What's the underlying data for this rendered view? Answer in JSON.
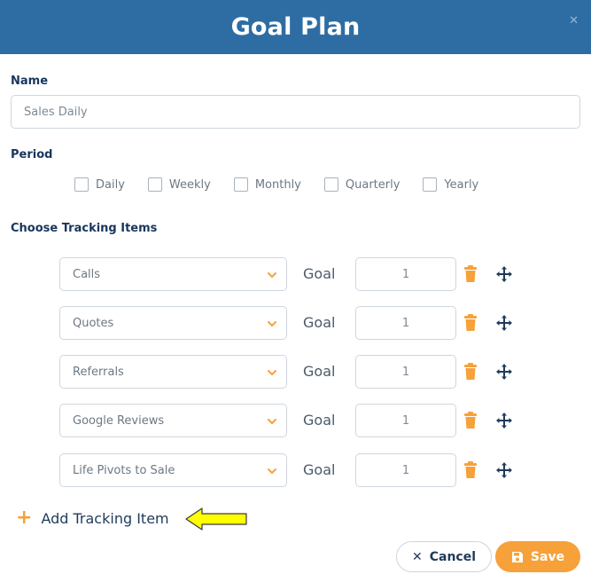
{
  "header": {
    "title": "Goal Plan",
    "close_icon": "close-icon"
  },
  "name": {
    "label": "Name",
    "value": "Sales Daily"
  },
  "period": {
    "label": "Period",
    "options": [
      "Daily",
      "Weekly",
      "Monthly",
      "Quarterly",
      "Yearly"
    ]
  },
  "tracking": {
    "label": "Choose Tracking Items",
    "goal_label": "Goal",
    "items": [
      {
        "name": "Calls",
        "goal": "1"
      },
      {
        "name": "Quotes",
        "goal": "1"
      },
      {
        "name": "Referrals",
        "goal": "1"
      },
      {
        "name": "Google Reviews",
        "goal": "1"
      },
      {
        "name": "Life Pivots to Sale",
        "goal": "1"
      }
    ],
    "add_label": "Add Tracking Item"
  },
  "footer": {
    "cancel_label": "Cancel",
    "save_label": "Save"
  },
  "colors": {
    "header": "#2e6da4",
    "accent": "#f7a13a",
    "navy": "#1f3b5a"
  }
}
